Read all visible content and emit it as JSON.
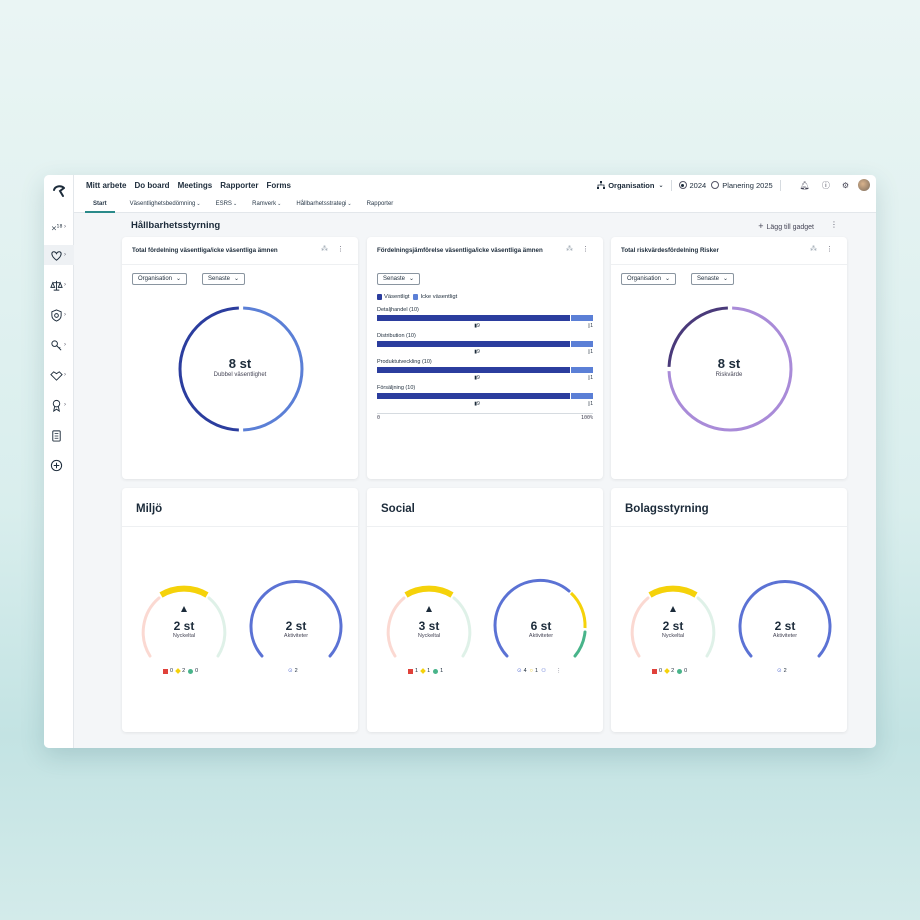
{
  "nav": {
    "items": [
      "Mitt arbete",
      "Do board",
      "Meetings",
      "Rapporter",
      "Forms"
    ],
    "org_label": "Organisation",
    "year_selected": "2024",
    "year_other": "Planering 2025"
  },
  "subnav": {
    "items": [
      {
        "label": "Start",
        "chevron": false
      },
      {
        "label": "Väsentlighetsbedömning",
        "chevron": true
      },
      {
        "label": "ESRS",
        "chevron": true
      },
      {
        "label": "Ramverk",
        "chevron": true
      },
      {
        "label": "Hållbarhetsstrategi",
        "chevron": true
      },
      {
        "label": "Rapporter",
        "chevron": false
      }
    ]
  },
  "page": {
    "title": "Hållbarhetsstyrning",
    "add_gadget": "Lägg till gadget"
  },
  "card1": {
    "title": "Total fördelning väsentliga/icke väsentliga ämnen",
    "filter1": "Organisation",
    "filter2": "Senaste",
    "center_value": "8 st",
    "center_label": "Dubbel väsentlighet",
    "segments": [
      {
        "value": 4,
        "color": "#5b7fd6"
      },
      {
        "value": 4,
        "color": "#2b3d9e"
      }
    ]
  },
  "card2": {
    "title": "Fördelningsjämförelse väsentliga/icke väsentliga ämnen",
    "filter1": "Senaste",
    "legend": [
      "Väsentligt",
      "Icke väsentligt"
    ],
    "colors": [
      "#2b3d9e",
      "#5b7fd6"
    ],
    "axis_min": "0",
    "axis_max": "100%",
    "rows": [
      {
        "label": "Detaljhandel (10)",
        "a": 9,
        "b": 1
      },
      {
        "label": "Distribution (10)",
        "a": 9,
        "b": 1
      },
      {
        "label": "Produktutveckling (10)",
        "a": 9,
        "b": 1
      },
      {
        "label": "Försäljning (10)",
        "a": 9,
        "b": 1
      }
    ]
  },
  "card3": {
    "title": "Total riskvärdesfördelning Risker",
    "filter1": "Organisation",
    "filter2": "Senaste",
    "center_value": "8 st",
    "center_label": "Riskvärde",
    "segments": [
      {
        "value": 6,
        "color": "#a98bd8"
      },
      {
        "value": 2,
        "color": "#4a3a7a"
      }
    ]
  },
  "bottom": [
    {
      "title": "Miljö",
      "left": {
        "value": "2 st",
        "label": "Nyckeltal"
      },
      "right": {
        "value": "2 st",
        "label": "Aktiviteter"
      },
      "counts": [
        "0",
        "2",
        "0"
      ],
      "act_count": "2"
    },
    {
      "title": "Social",
      "left": {
        "value": "3 st",
        "label": "Nyckeltal"
      },
      "right": {
        "value": "6 st",
        "label": "Aktiviteter"
      },
      "counts": [
        "1",
        "1",
        "1"
      ],
      "act_count": "4",
      "act_count2": "1"
    },
    {
      "title": "Bolagsstyrning",
      "left": {
        "value": "2 st",
        "label": "Nyckeltal"
      },
      "right": {
        "value": "2 st",
        "label": "Aktiviteter"
      },
      "counts": [
        "0",
        "2",
        "0"
      ],
      "act_count": "2"
    }
  ],
  "colors": {
    "accent": "#2a8a8a",
    "red": "#e0413a",
    "yellow": "#f5d20a",
    "green": "#48b48a",
    "blue": "#5b72d4"
  }
}
